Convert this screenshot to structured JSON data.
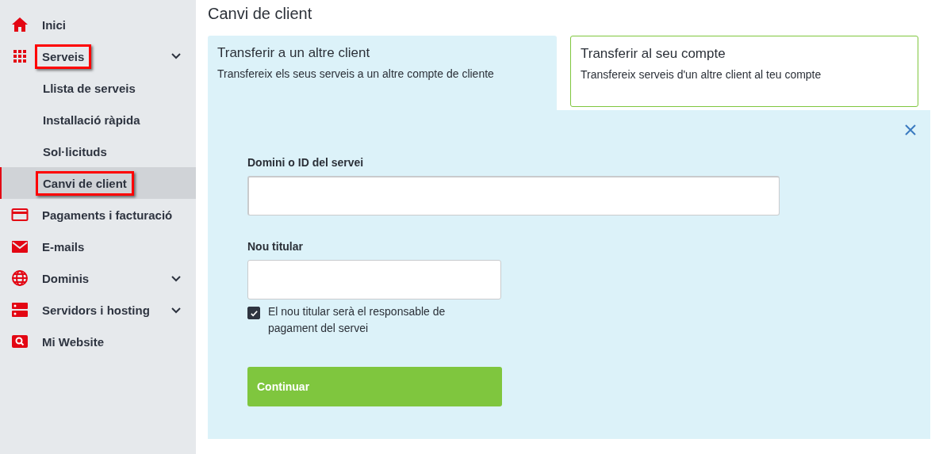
{
  "sidebar": {
    "items": [
      {
        "label": "Inici",
        "kind": "home",
        "selected": false,
        "highlighted": false
      },
      {
        "label": "Serveis",
        "kind": "grid",
        "selected": false,
        "highlighted": true,
        "expanded": true,
        "children": [
          {
            "label": "Llista de serveis",
            "selected": false,
            "highlighted": false
          },
          {
            "label": "Installació ràpida",
            "selected": false,
            "highlighted": false
          },
          {
            "label": "Sol·licituds",
            "selected": false,
            "highlighted": false
          },
          {
            "label": "Canvi de client",
            "selected": true,
            "highlighted": true
          }
        ]
      },
      {
        "label": "Pagaments i facturació",
        "kind": "card",
        "selected": false,
        "highlighted": false
      },
      {
        "label": "E-mails",
        "kind": "mail",
        "selected": false,
        "highlighted": false
      },
      {
        "label": "Dominis",
        "kind": "globe",
        "selected": false,
        "highlighted": false,
        "expanded": false
      },
      {
        "label": "Servidors i hosting",
        "kind": "server",
        "selected": false,
        "highlighted": false,
        "expanded": false
      },
      {
        "label": "Mi Website",
        "kind": "search",
        "selected": false,
        "highlighted": false
      }
    ]
  },
  "page": {
    "title": "Canvi de client"
  },
  "tabs": [
    {
      "title": "Transferir a un altre client",
      "description": "Transfereix els seus serveis a un altre compte de cliente",
      "selected": true
    },
    {
      "title": "Transferir al seu compte",
      "description": "Transfereix serveis d'un altre client al teu compte",
      "selected": false
    }
  ],
  "form": {
    "fields": [
      {
        "label": "Domini o ID del servei"
      },
      {
        "label": "Nou titular"
      }
    ],
    "checkbox": {
      "label": "El nou titular serà el responsable de pagament del servei",
      "checked": true
    },
    "button": "Continuar"
  }
}
